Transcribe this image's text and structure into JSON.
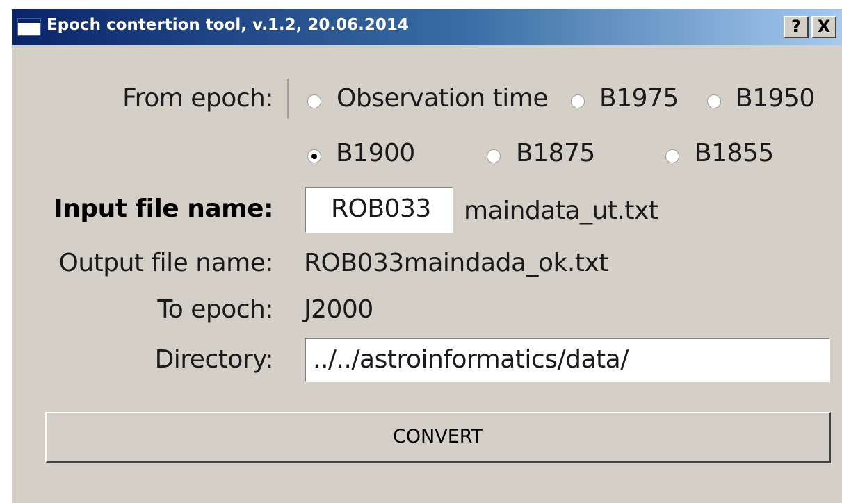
{
  "window": {
    "title": "Epoch contertion tool, v.1.2, 20.06.2014",
    "help_button": "?",
    "close_button": "X"
  },
  "from_epoch": {
    "label": "From epoch:",
    "options": [
      "Observation time",
      "B1975",
      "B1950",
      "B1900",
      "B1875",
      "B1855"
    ],
    "selected": "B1900"
  },
  "input_file": {
    "label": "Input file name:",
    "prefix_value": "ROB033",
    "suffix": "maindata_ut.txt"
  },
  "output_file": {
    "label": "Output file name:",
    "value": "ROB033maindada_ok.txt"
  },
  "to_epoch": {
    "label": "To epoch:",
    "value": "J2000"
  },
  "directory": {
    "label": "Directory:",
    "value": "../../astroinformatics/data/"
  },
  "convert_button": "CONVERT"
}
